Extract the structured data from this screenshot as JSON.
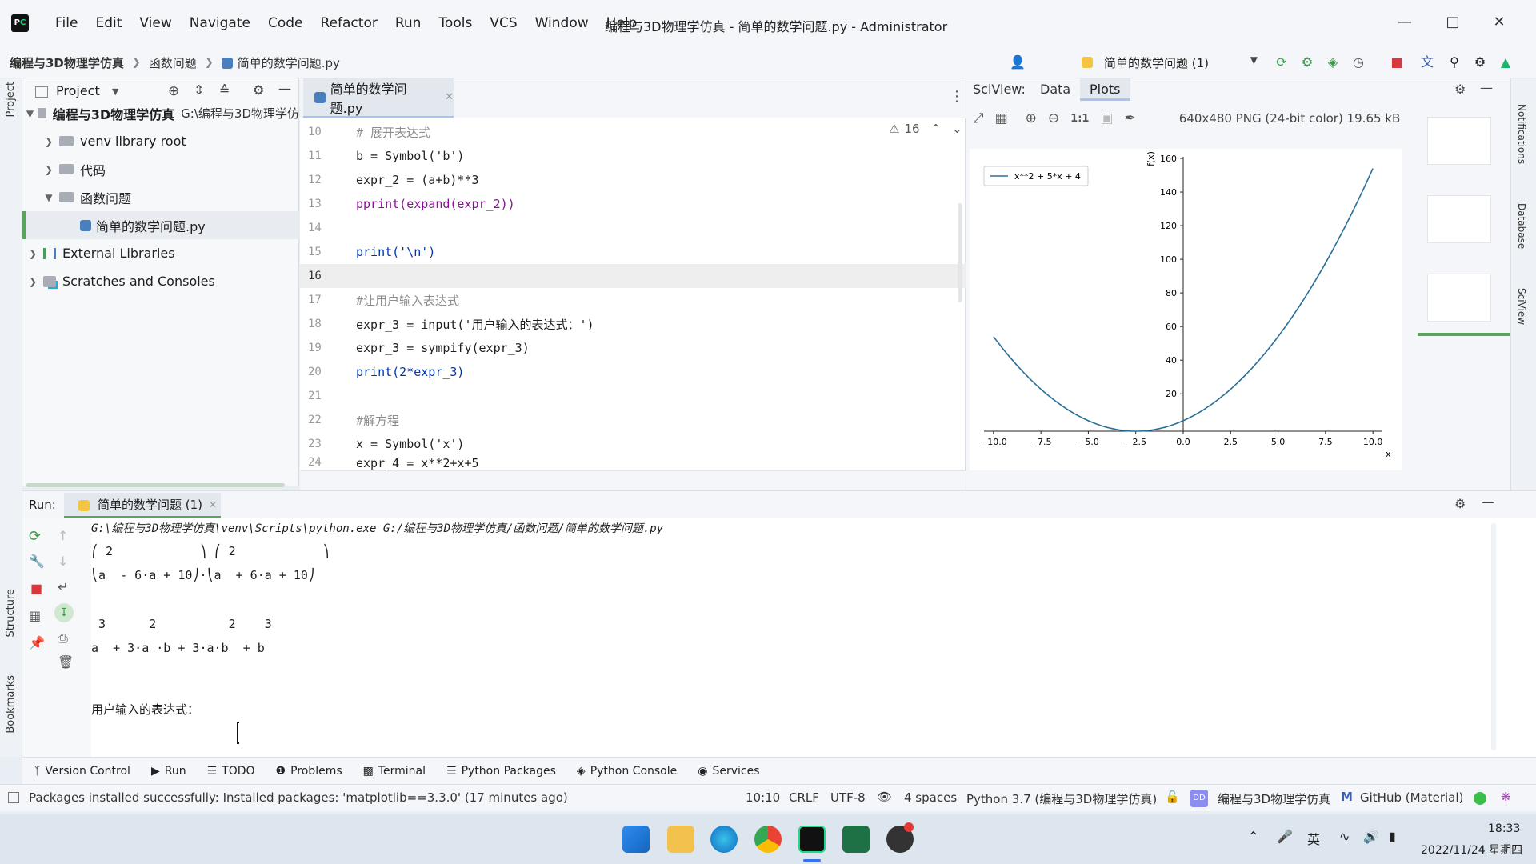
{
  "app": {
    "window_title": "编程与3D物理学仿真 - 简单的数学问题.py - Administrator",
    "menu": [
      "File",
      "Edit",
      "View",
      "Navigate",
      "Code",
      "Refactor",
      "Run",
      "Tools",
      "VCS",
      "Window",
      "Help"
    ]
  },
  "breadcrumb": [
    "编程与3D物理学仿真",
    "函数问题",
    "简单的数学问题.py"
  ],
  "run_config": "简单的数学问题 (1)",
  "project": {
    "header": "Project",
    "tree": [
      {
        "label": "编程与3D物理学仿真",
        "path": "G:\\编程与3D物理学仿",
        "bold": true
      },
      {
        "label": "venv  library root"
      },
      {
        "label": "代码"
      },
      {
        "label": "函数问题"
      },
      {
        "label": "简单的数学问题.py"
      },
      {
        "label": "External Libraries"
      },
      {
        "label": "Scratches and Consoles"
      }
    ]
  },
  "editor": {
    "tab": "简单的数学问题.py",
    "inspection_count": "16",
    "lines": [
      {
        "n": "10",
        "code": "# 展开表达式"
      },
      {
        "n": "11",
        "code": "b = Symbol('b')"
      },
      {
        "n": "12",
        "code": "expr_2 = (a+b)**3"
      },
      {
        "n": "13",
        "code": "pprint(expand(expr_2))"
      },
      {
        "n": "14",
        "code": ""
      },
      {
        "n": "15",
        "code": "print('\\n')"
      },
      {
        "n": "16",
        "code": ""
      },
      {
        "n": "17",
        "code": "#让用户输入表达式"
      },
      {
        "n": "18",
        "code": "expr_3 = input('用户输入的表达式：')"
      },
      {
        "n": "19",
        "code": "expr_3 = sympify(expr_3)"
      },
      {
        "n": "20",
        "code": "print(2*expr_3)"
      },
      {
        "n": "21",
        "code": ""
      },
      {
        "n": "22",
        "code": "#解方程"
      },
      {
        "n": "23",
        "code": "x = Symbol('x')"
      },
      {
        "n": "24",
        "code": "expr_4 = x**2+x+5"
      }
    ]
  },
  "sciview": {
    "label": "SciView:",
    "tabs": [
      "Data",
      "Plots"
    ],
    "image_info": "640x480 PNG (24-bit color) 19.65 kB",
    "side_labels": [
      "Notifications",
      "Database",
      "SciView"
    ]
  },
  "chart_data": {
    "type": "line",
    "series": [
      {
        "name": "x**2 + 5*x + 4",
        "x": [
          -10,
          -7.5,
          -5,
          -2.5,
          0,
          2.5,
          5,
          7.5,
          10
        ],
        "y": [
          54,
          22.75,
          4,
          -2.25,
          4,
          22.75,
          54,
          97.75,
          154
        ]
      }
    ],
    "xticks": [
      "−10.0",
      "−7.5",
      "−5.0",
      "−2.5",
      "0.0",
      "2.5",
      "5.0",
      "7.5",
      "10.0"
    ],
    "yticks": [
      "20",
      "40",
      "60",
      "80",
      "100",
      "120",
      "140",
      "160"
    ],
    "xlabel": "x",
    "ylabel": "f(x)",
    "xlim": [
      -10.5,
      10.5
    ],
    "ylim": [
      -2.25,
      160
    ],
    "legend": "top-left"
  },
  "run": {
    "label": "Run:",
    "tab": "简单的数学问题 (1)",
    "output": [
      "G:\\编程与3D物理学仿真\\venv\\Scripts\\python.exe G:/编程与3D物理学仿真/函数问题/简单的数学问题.py",
      "⎛ 2            ⎞ ⎛ 2            ⎞",
      "⎝a  - 6⋅a + 10⎠⋅⎝a  + 6⋅a + 10⎠",
      " 3      2          2    3",
      "a  + 3⋅a ⋅b + 3⋅a⋅b  + b",
      "用户输入的表达式："
    ]
  },
  "bottom_tools": [
    "Version Control",
    "Run",
    "TODO",
    "Problems",
    "Terminal",
    "Python Packages",
    "Python Console",
    "Services"
  ],
  "status": {
    "message": "Packages installed successfully: Installed packages: 'matplotlib==3.3.0' (17 minutes ago)",
    "position": "10:10",
    "line_sep": "CRLF",
    "encoding": "UTF-8",
    "indent": "4 spaces",
    "interpreter": "Python 3.7 (编程与3D物理学仿真)",
    "project_badge": "DD",
    "project": "编程与3D物理学仿真",
    "theme": "GitHub (Material)"
  },
  "taskbar": {
    "ime": "英",
    "time": "18:33",
    "date": "2022/11/24 星期四"
  },
  "left_strip": [
    "Project",
    "Structure",
    "Bookmarks"
  ],
  "colors": {
    "accent": "#3574f0",
    "run_green": "#58a55c",
    "plot_line": "#2a6f97"
  }
}
